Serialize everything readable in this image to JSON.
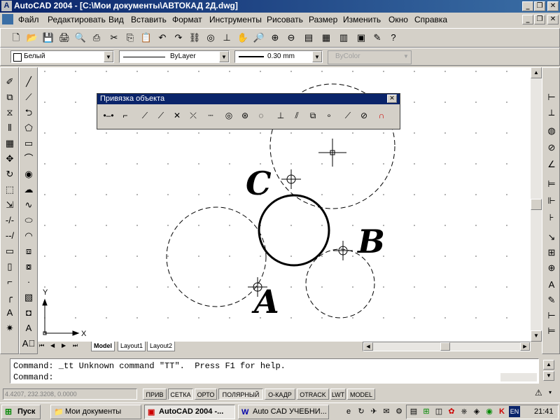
{
  "window": {
    "app_icon": "A",
    "title": "AutoCAD 2004 - [C:\\Мои документы\\АВТОКАД 2Д.dwg]"
  },
  "menu": [
    "Файл",
    "Редактировать",
    "Вид",
    "Вставить",
    "Формат",
    "Инструменты",
    "Рисовать",
    "Размер",
    "Изменить",
    "Окно",
    "Справка"
  ],
  "properties": {
    "layer_color": "Белый",
    "linetype": "ByLayer",
    "lineweight": "0.30 mm",
    "plot_style": "ByColor"
  },
  "osnap_toolbar": {
    "title": "Привязка объекта"
  },
  "drawing": {
    "label_a": "A",
    "label_b": "B",
    "label_c": "C",
    "ucs_x": "X",
    "ucs_y": "Y"
  },
  "layout_tabs": [
    "Model",
    "Layout1",
    "Layout2"
  ],
  "command": {
    "line1": "Command: _tt Unknown command \"TT\".  Press F1 for help.",
    "line2": "Command:"
  },
  "status": {
    "coords": "4.4207, 232.3208, 0.0000",
    "buttons": [
      "ПРИВ",
      "СЕТКА",
      "ОРТО",
      "ПОЛЯРНЫЙ",
      "О-КАДР",
      "OTRACK",
      "LWT",
      "MODEL"
    ]
  },
  "taskbar": {
    "start": "Пуск",
    "tasks": [
      "Мои документы",
      "AutoCAD 2004 -...",
      "Auto CAD УЧЕБНИ..."
    ],
    "lang": "EN",
    "clock": "21:41"
  },
  "colors": {
    "title_bar": "#0a246a",
    "canvas": "#ffffff",
    "window_bg": "#d4d0c8"
  }
}
